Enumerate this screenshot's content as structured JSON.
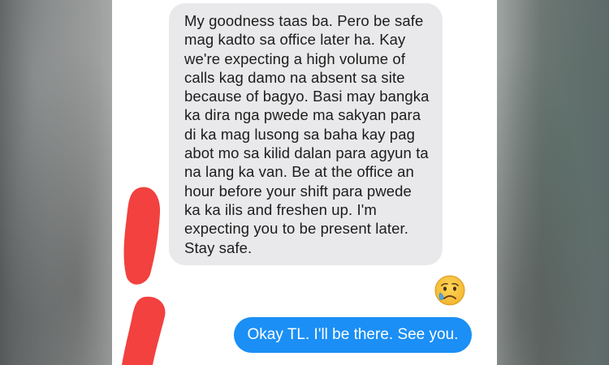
{
  "conversation": {
    "incoming_message": "My goodness taas ba. Pero be safe mag kadto sa office later ha. Kay we're expecting a high volume of calls kag damo na absent sa site because of bagyo. Basi may bangka ka dira nga pwede ma sakyan para di ka mag lusong sa baha kay pag abot mo sa kilid dalan para agyun ta na lang ka van. Be at the office an hour before your shift para pwede ka ka ilis and freshen up. I'm expecting you to be present later. Stay safe.",
    "reaction_icon": "crying-face-emoji",
    "outgoing_message": "Okay TL. I'll be there. See you."
  },
  "colors": {
    "incoming_bubble": "#e9e9eb",
    "outgoing_bubble": "#1b8ff5",
    "annotation_marks": "#f2413f",
    "emoji_face": "#f7c53c",
    "emoji_tear": "#4aa6e8"
  }
}
